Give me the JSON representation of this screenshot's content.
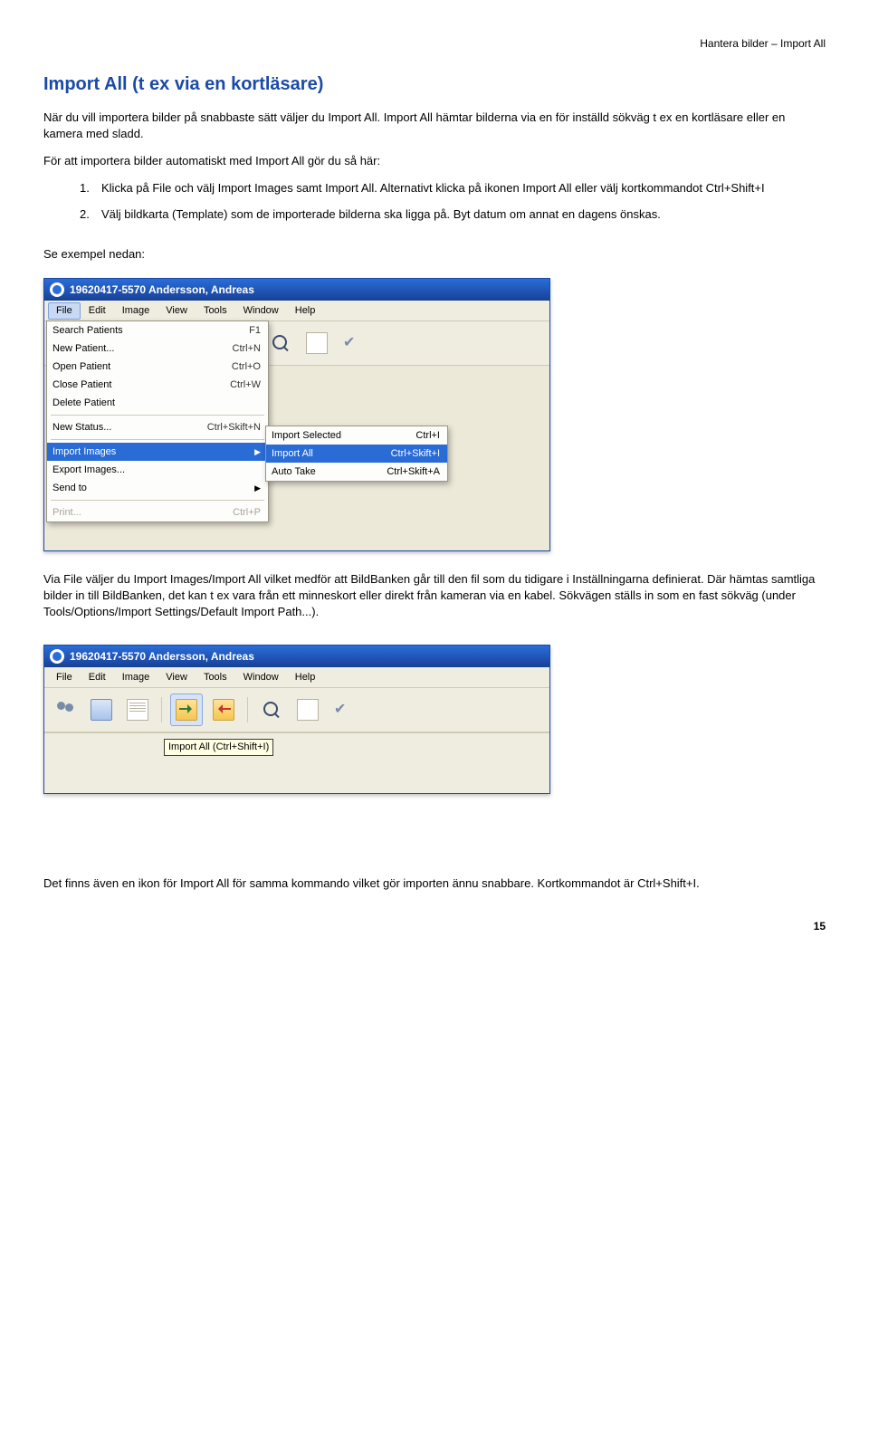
{
  "header": {
    "right": "Hantera bilder – Import All"
  },
  "title": "Import All (t ex via en kortläsare)",
  "intro": "När du vill importera bilder på snabbaste sätt väljer du Import All. Import All hämtar bilderna via en för inställd sökväg t ex en kortläsare eller en kamera med sladd.",
  "sub": "För att importera bilder automatiskt med Import All gör du så här:",
  "steps": [
    "Klicka på File och välj Import Images samt Import All. Alternativt klicka på ikonen Import All eller välj kortkommandot Ctrl+Shift+I",
    "Välj bildkarta (Template) som de importerade bilderna ska ligga på. Byt datum om annat en dagens önskas."
  ],
  "example_lead": "Se exempel nedan:",
  "app_title": "19620417-5570 Andersson, Andreas",
  "menubar": [
    "File",
    "Edit",
    "Image",
    "View",
    "Tools",
    "Window",
    "Help"
  ],
  "file_menu": [
    {
      "label": "Search Patients",
      "sc": "F1"
    },
    {
      "label": "New Patient...",
      "sc": "Ctrl+N"
    },
    {
      "label": "Open Patient",
      "sc": "Ctrl+O"
    },
    {
      "label": "Close Patient",
      "sc": "Ctrl+W"
    },
    {
      "label": "Delete Patient",
      "sc": ""
    }
  ],
  "file_menu2": [
    {
      "label": "New Status...",
      "sc": "Ctrl+Skift+N"
    }
  ],
  "file_menu3": [
    {
      "label": "Import Images",
      "sc": "",
      "chev": true,
      "hl": true
    },
    {
      "label": "Export Images...",
      "sc": ""
    },
    {
      "label": "Send to",
      "sc": "",
      "chev": true
    }
  ],
  "file_menu4": [
    {
      "label": "Print...",
      "sc": "Ctrl+P",
      "disabled": true
    }
  ],
  "submenu": [
    {
      "label": "Import Selected",
      "sc": "Ctrl+I"
    },
    {
      "label": "Import All",
      "sc": "Ctrl+Skift+I",
      "hl": true
    },
    {
      "label": "Auto Take",
      "sc": "Ctrl+Skift+A"
    }
  ],
  "para_mid": "Via File väljer du Import Images/Import All vilket medför att BildBanken går till den fil som du tidigare i Inställningarna definierat. Där hämtas samtliga bilder in till BildBanken, det kan t ex vara från ett minneskort eller direkt från kameran via en kabel. Sökvägen ställs in som en fast sökväg (under Tools/Options/Import Settings/Default Import Path...).",
  "tooltip": "Import All (Ctrl+Shift+I)",
  "para_end": "Det finns även en ikon för Import All för samma kommando vilket gör importen ännu snabbare. Kortkommandot är Ctrl+Shift+I.",
  "page_number": "15"
}
